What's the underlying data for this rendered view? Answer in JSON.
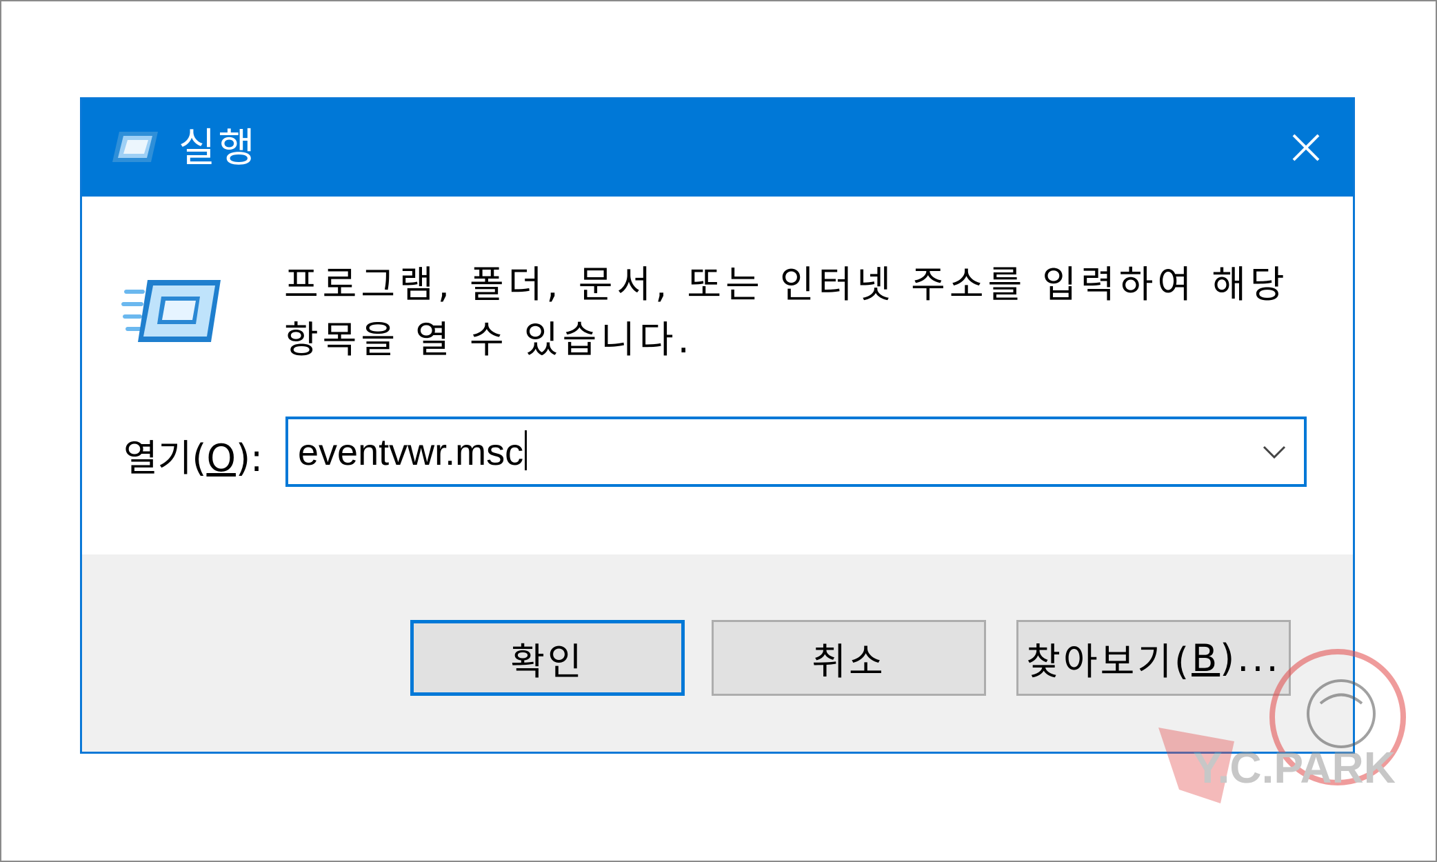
{
  "dialog": {
    "title": "실행",
    "description": "프로그램, 폴더, 문서, 또는 인터넷 주소를 입력하여 해당 항목을 열 수 있습니다.",
    "open_label_prefix": "열기(",
    "open_label_mnemonic": "O",
    "open_label_suffix": "):",
    "open_value": "eventvwr.msc",
    "buttons": {
      "ok": "확인",
      "cancel": "취소",
      "browse_prefix": "찾아보기(",
      "browse_mnemonic": "B",
      "browse_suffix": ")..."
    }
  },
  "watermark_text": "Y.C.PARK",
  "colors": {
    "titlebar": "#0078d7",
    "focus_border": "#0078d7",
    "footer": "#f0f0f0",
    "button_face": "#e1e1e1"
  },
  "icons": [
    "run-icon",
    "close-icon",
    "chevron-down-icon"
  ]
}
